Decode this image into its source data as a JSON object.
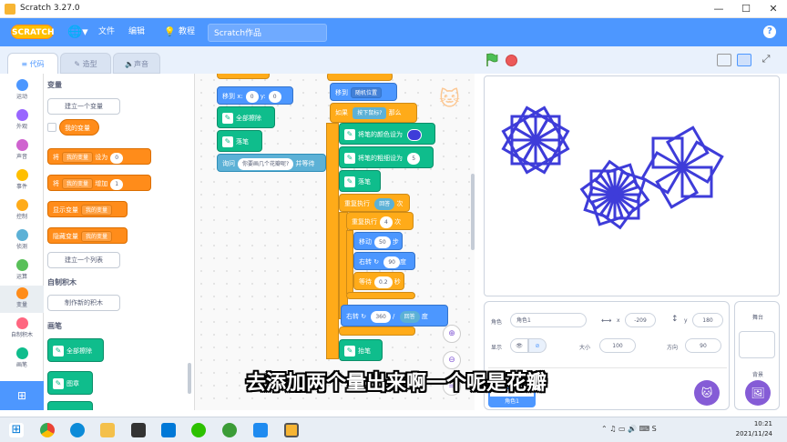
{
  "window": {
    "title": "Scratch 3.27.0"
  },
  "menubar": {
    "logo": "SCRATCH",
    "file": "文件",
    "edit": "编辑",
    "tutorials": "教程",
    "project_title": "Scratch作品",
    "help": "?"
  },
  "tabs": {
    "code": "代码",
    "costumes": "造型",
    "sounds": "声音"
  },
  "categories": [
    {
      "label": "运动",
      "color": "#4c97ff"
    },
    {
      "label": "外观",
      "color": "#9966ff"
    },
    {
      "label": "声音",
      "color": "#cf63cf"
    },
    {
      "label": "事件",
      "color": "#ffbf00"
    },
    {
      "label": "控制",
      "color": "#ffab19"
    },
    {
      "label": "侦测",
      "color": "#5cb1d6"
    },
    {
      "label": "运算",
      "color": "#59c059"
    },
    {
      "label": "变量",
      "color": "#ff8c1a"
    },
    {
      "label": "自制积木",
      "color": "#ff6680"
    },
    {
      "label": "画笔",
      "color": "#0fbd8c"
    }
  ],
  "palette": {
    "variables_title": "变量",
    "make_variable": "建立一个变量",
    "my_variable": "我的变量",
    "set_block": "将",
    "set_to": "设为",
    "set_value": "0",
    "change_block": "将",
    "change_by": "增加",
    "change_value": "1",
    "show_var": "显示变量",
    "hide_var": "隐藏变量",
    "make_list": "建立一个列表",
    "myblocks_title": "自制积木",
    "make_block": "制作新的积木",
    "pen_title": "画笔",
    "pen_clear": "全部擦除",
    "pen_stamp": "图章"
  },
  "script": {
    "goto_x": "移到 x:",
    "x_val": "0",
    "y_label": "y:",
    "y_val": "0",
    "erase_all": "全部擦除",
    "pen_down": "落笔",
    "ask": "询问",
    "ask_text": "你要画几个花瓣呢?",
    "ask_wait": "并等待",
    "move_to": "移到",
    "random_pos": "随机位置",
    "if": "如果",
    "mouse_down": "按下鼠标?",
    "then": "那么",
    "set_pen_color": "将笔的颜色设为",
    "set_pen_size": "将笔的粗细设为",
    "pen_size_val": "5",
    "pen_down2": "落笔",
    "repeat": "重复执行",
    "answer": "回答",
    "times": "次",
    "repeat2": "重复执行",
    "repeat2_val": "4",
    "move": "移动",
    "move_val": "50",
    "steps": "步",
    "turn": "右转",
    "turn_val": "90",
    "degrees": "度",
    "wait": "等待",
    "wait_val": "0.2",
    "seconds": "秒",
    "turn2": "右转",
    "turn2_val": "360",
    "divide": "/",
    "answer2": "回答",
    "degrees2": "度",
    "pen_up": "抬笔"
  },
  "sprite_panel": {
    "sprite_label": "角色",
    "sprite_name": "角色1",
    "x_label": "x",
    "x_val": "-209",
    "y_label": "y",
    "y_val": "180",
    "show_label": "显示",
    "size_label": "大小",
    "size_val": "100",
    "direction_label": "方向",
    "direction_val": "90",
    "sprite_thumb_label": "角色1"
  },
  "stage_panel": {
    "title": "舞台",
    "backdrops": "背景"
  },
  "subtitle": "去添加两个量出来啊一个呢是花瓣",
  "taskbar": {
    "time": "10:21",
    "date": "2021/11/24"
  },
  "colors": {
    "accent": "#4d97ff",
    "pen_color": "#3e3cd9"
  }
}
